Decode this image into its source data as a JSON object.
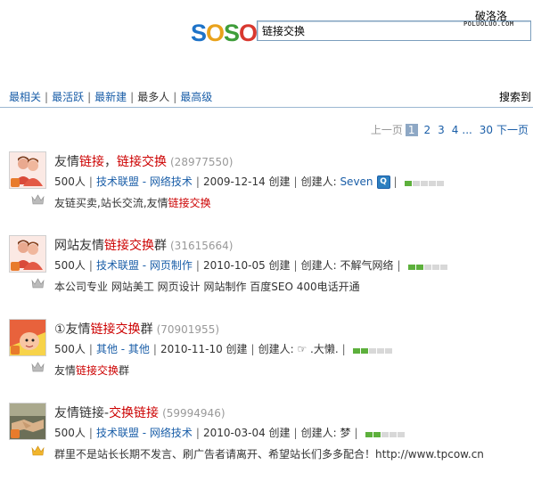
{
  "header": {
    "logo_letters": [
      "S",
      "O",
      "S",
      "O"
    ],
    "logo_colors": [
      "#1e73c8",
      "#e9a21b",
      "#3f9d3a",
      "#d8382f"
    ],
    "search_value": "链接交换",
    "watermark_cn": "破洛洛",
    "watermark_en": "POLUOLUO.COM"
  },
  "tabs": [
    {
      "label": "最相关"
    },
    {
      "label": "最活跃"
    },
    {
      "label": "最新建"
    },
    {
      "label": "最多人"
    },
    {
      "label": "最高级"
    }
  ],
  "right_link": "搜索到",
  "pager": {
    "prev": "上一页",
    "current": "1",
    "pages": [
      "2",
      "3",
      "4"
    ],
    "ellipsis": "...",
    "last": "30",
    "next": "下一页"
  },
  "results": [
    {
      "title_parts": [
        {
          "t": "友情",
          "h": false
        },
        {
          "t": "链接",
          "h": true
        },
        {
          "t": "，",
          "h": false
        },
        {
          "t": "链接交换",
          "h": true
        }
      ],
      "gid": "(28977550)",
      "members": "500人",
      "category": "技术联盟 - 网络技术",
      "created": "2009-12-14 创建",
      "creator_label": "创建人:",
      "creator": "Seven",
      "has_qq_icon": true,
      "level_on": 1,
      "desc_parts": [
        {
          "t": "友链买卖,站长交流,友情",
          "h": false
        },
        {
          "t": "链接交换",
          "h": true
        }
      ],
      "avatar": "people"
    },
    {
      "title_parts": [
        {
          "t": "网站友情",
          "h": false
        },
        {
          "t": "链接交换",
          "h": true
        },
        {
          "t": "群",
          "h": false
        }
      ],
      "gid": "(31615664)",
      "members": "500人",
      "category": "技术联盟 - 网页制作",
      "created": "2010-10-05 创建",
      "creator_label": "创建人:",
      "creator": "不解气网络",
      "has_qq_icon": false,
      "level_on": 2,
      "desc_parts": [
        {
          "t": "本公司专业 网站美工 网页设计 网站制作 百度SEO 400电话开通",
          "h": false
        }
      ],
      "avatar": "people"
    },
    {
      "title_parts": [
        {
          "t": "①友情",
          "h": false
        },
        {
          "t": "链接交换",
          "h": true
        },
        {
          "t": "群",
          "h": false
        }
      ],
      "gid": "(70901955)",
      "members": "500人",
      "category": "其他 - 其他",
      "created": "2010-11-10 创建",
      "creator_label": "创建人:",
      "creator": "☞ .大懒.",
      "has_qq_icon": false,
      "level_on": 2,
      "desc_parts": [
        {
          "t": "友情",
          "h": false
        },
        {
          "t": "链接交换",
          "h": true
        },
        {
          "t": "群",
          "h": false
        }
      ],
      "avatar": "cartoon"
    },
    {
      "title_parts": [
        {
          "t": "友情链接-",
          "h": false
        },
        {
          "t": "交换链接",
          "h": true
        }
      ],
      "gid": "(59994946)",
      "members": "500人",
      "category": "技术联盟 - 网络技术",
      "created": "2010-03-04 创建",
      "creator_label": "创建人:",
      "creator": "梦",
      "has_qq_icon": false,
      "level_on": 2,
      "desc_parts": [
        {
          "t": "群里不是站长长期不发言、刷广告者请离开、希望站长们多多配合！http://www.tpcow.cn",
          "h": false
        }
      ],
      "avatar": "handshake"
    }
  ]
}
